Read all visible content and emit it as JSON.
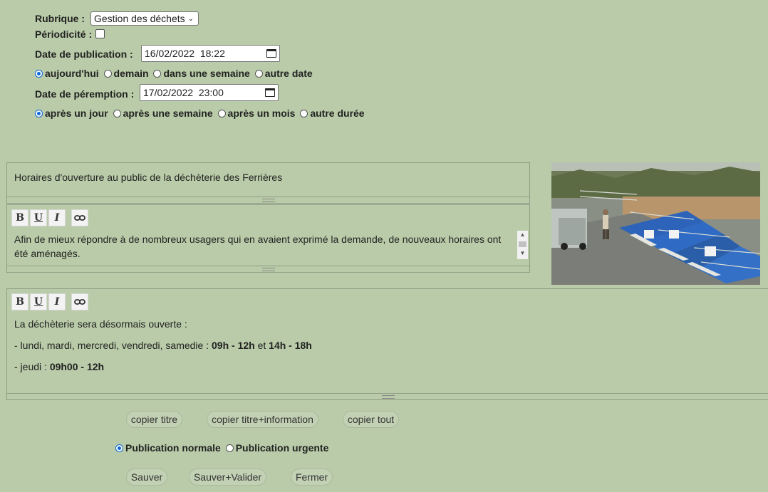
{
  "form": {
    "rubrique_label": "Rubrique :",
    "rubrique_value": "Gestion des déchets",
    "periodicite_label": "Périodicité :",
    "pub_date_label": "Date de publication :",
    "pub_date_value": "16/02/2022  18:22",
    "pub_options": [
      "aujourd'hui",
      "demain",
      "dans une semaine",
      "autre date"
    ],
    "exp_date_label": "Date de péremption :",
    "exp_date_value": "17/02/2022  23:00",
    "exp_options": [
      "après un jour",
      "après une semaine",
      "après un mois",
      "autre durée"
    ]
  },
  "editor": {
    "title_text": "Horaires d'ouverture au public de la déchèterie des Ferrières",
    "summary_text": "Afin de mieux répondre à de nombreux usagers qui en avaient exprimé la demande, de nouveaux horaires ont été aménagés.",
    "toolbar": {
      "bold": "B",
      "underline": "U",
      "italic": "I"
    },
    "body": {
      "line1": "La déchèterie sera désormais ouverte :",
      "line2_prefix": "- lundi, mardi, mercredi, vendredi, samedie : ",
      "line2_bold1": "09h - 12h",
      "line2_mid": " et ",
      "line2_bold2": "14h - 18h",
      "line3_prefix": "- jeudi : ",
      "line3_bold": "09h00 - 12h"
    }
  },
  "actions": {
    "copy_title": "copier titre",
    "copy_title_info": "copier titre+information",
    "copy_all": "copier tout",
    "pub_normal": "Publication normale",
    "pub_urgent": "Publication urgente",
    "save": "Sauver",
    "save_validate": "Sauver+Valider",
    "close": "Fermer"
  }
}
